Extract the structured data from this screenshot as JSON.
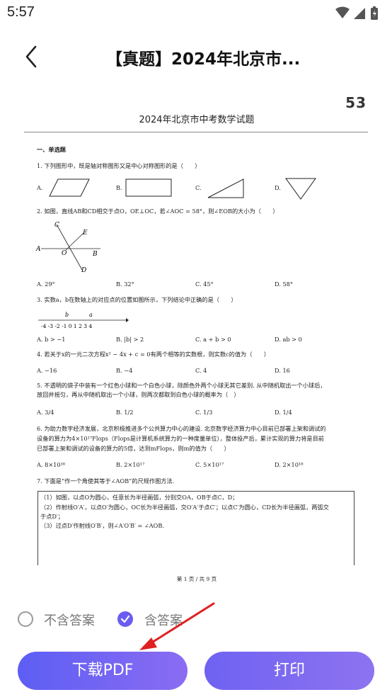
{
  "status": {
    "time": "5:57"
  },
  "header": {
    "title": "【真题】2024年北京市..."
  },
  "doc": {
    "logo": "53",
    "title": "2024年北京市中考数学试题",
    "section": "一、单选题",
    "q1": "1. 下列图形中，既是轴对称图形又是中心对称图形的是（　　）",
    "q1_opts": [
      "A.",
      "B.",
      "C.",
      "D."
    ],
    "q2": "2. 如图，直线AB和CD相交于点O，OE⊥OC，若∠AOC = 58°，则∠EOB的大小为（　　）",
    "q2_fig": {
      "C": "C",
      "E": "E",
      "A": "A",
      "O": "O",
      "B": "B",
      "D": "D"
    },
    "q2_opts": [
      "A.  29°",
      "B.  32°",
      "C.  45°",
      "D.  58°"
    ],
    "q3": "3. 实数a，b在数轴上的对应点的位置如图所示，下列结论中正确的是（　　）",
    "q3_axis": "-4 -3 -2 -1  0  1  2  3  4",
    "q3_a": "a",
    "q3_b": "b",
    "q3_opts": [
      "A.  b > −1",
      "B.  |b| > 2",
      "C.  a + b > 0",
      "D.  ab > 0"
    ],
    "q4": "4. 若关于x的一元二次方程x² − 4x + c = 0有两个相等的实数根，则实数c的值为（　　）",
    "q4_opts": [
      "A.  −16",
      "B.  −4",
      "C.  4",
      "D.  16"
    ],
    "q5a": "5. 不透明的袋子中装有一个红色小球和一个白色小球，除颜色外两个小球无其它差别. 从中随机取出一个小球后，",
    "q5b": "放回并摇匀，再从中随机取出一个小球，则两次都取到白色小球的概率为（　）",
    "q5_opts": [
      "A.  3/4",
      "B.  1/2",
      "C.  1/3",
      "D.  1/4"
    ],
    "q6a": "6. 为助力数字经济发展，北京积极推进多个公共算力中心的建设. 北京数字经济算力中心目前已部署上架和调试的",
    "q6b": "设备的算力为4×10¹⁷Flops（Flops是计算机系统算力的一种度量单位），整体投产后，累计实现的算力将是目前",
    "q6c": "已部署上架和调试的设备的算力的5倍，达到mFlops，则m的值为（　　）",
    "q6_opts": [
      "A.  8×10¹⁶",
      "B.  2×10¹⁷",
      "C.  5×10¹⁷",
      "D.  2×10¹⁸"
    ],
    "q7": "7. 下面是“作一个角使其等于∠AOB”的尺规作图方法.",
    "q7_l1": "（1）如图，以点O为圆心，任意长为半径画弧，分别交OA，OB于点C，D；",
    "q7_l2": "（2）作射线O′A′，以点O′为圆心，OC长为半径画弧，交O′A′于点C′；以点C′为圆心，CD长为半径画弧，两弧交",
    "q7_l3": "于点D′；",
    "q7_l4": "（3）过点D′作射线O′B′，则∠A′O′B′ = ∠AOB.",
    "footer": "第 1 页 / 共 9 页"
  },
  "options": {
    "no_answer": "不含答案",
    "with_answer": "含答案",
    "selected": "with_answer"
  },
  "buttons": {
    "download": "下载PDF",
    "print": "打印"
  },
  "colors": {
    "accent": "#6a5cf0",
    "arrow": "#e02020"
  }
}
